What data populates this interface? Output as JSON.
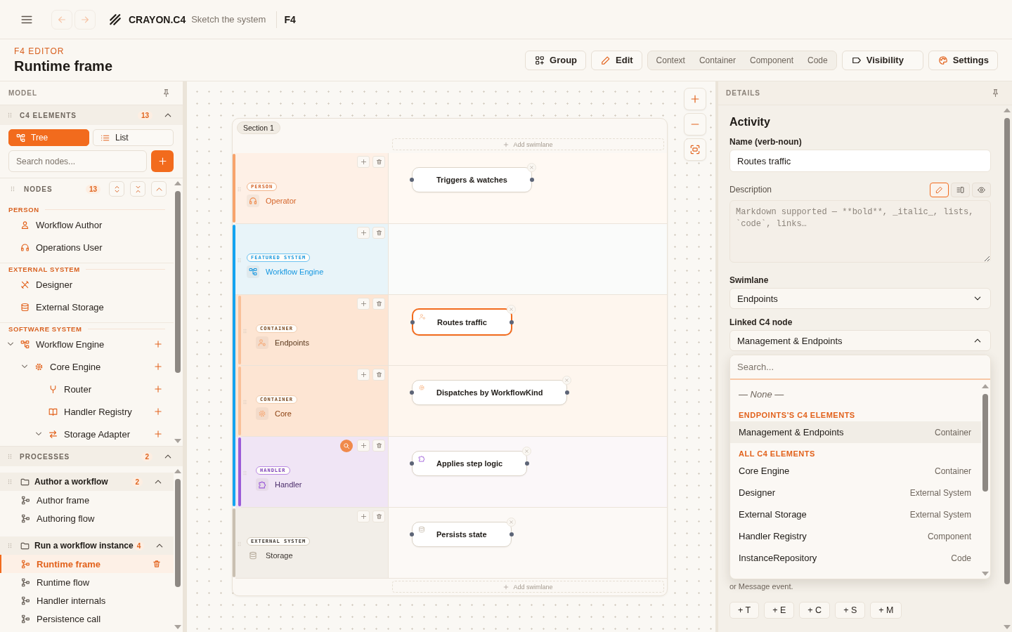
{
  "top_bar": {
    "nav_buttons": [
      {
        "kind": "back",
        "disabled": true
      },
      {
        "kind": "forward",
        "disabled": true
      }
    ],
    "app_name": "CRAYON.C4",
    "tagline": "Sketch the system",
    "document": "F4"
  },
  "header": {
    "eyebrow": "F4 EDITOR",
    "title": "Runtime frame",
    "toolbar": [
      {
        "kind": "group",
        "label": "Group"
      },
      {
        "kind": "edit",
        "label": "Edit"
      },
      {
        "kind": "levels",
        "options": [
          "Context",
          "Container",
          "Component",
          "Code"
        ]
      },
      {
        "kind": "visibility",
        "label": "Visibility"
      },
      {
        "kind": "settings",
        "label": "Settings"
      }
    ]
  },
  "sidebar": {
    "title": "MODEL",
    "c4_elements": {
      "title": "C4 ELEMENTS",
      "count": "13",
      "expanded": true,
      "view_modes": [
        {
          "kind": "tree",
          "label": "Tree",
          "selected": true
        },
        {
          "kind": "list",
          "label": "List",
          "selected": false
        }
      ],
      "search": {
        "placeholder": "Search nodes..."
      },
      "nodes_header": {
        "title": "NODES",
        "count": "13",
        "expanded": true
      },
      "groups": [
        {
          "title": "PERSON",
          "addable": false,
          "items": [
            {
              "label": "Workflow Author",
              "kind": "user"
            },
            {
              "label": "Operations User",
              "kind": "operator"
            }
          ]
        },
        {
          "title": "EXTERNAL SYSTEM",
          "addable": false,
          "items": [
            {
              "label": "Designer",
              "kind": "tools"
            },
            {
              "label": "External Storage",
              "kind": "database"
            }
          ]
        },
        {
          "title": "SOFTWARE SYSTEM",
          "addable": true,
          "items": [
            {
              "label": "Workflow Engine",
              "kind": "system",
              "expanded": true,
              "children": [
                {
                  "label": "Core Engine",
                  "kind": "engine",
                  "expanded": true,
                  "children": [
                    {
                      "label": "Router",
                      "kind": "router"
                    },
                    {
                      "label": "Handler Registry",
                      "kind": "registry"
                    },
                    {
                      "label": "Storage Adapter",
                      "kind": "adapter",
                      "expanded": true
                    }
                  ]
                }
              ]
            }
          ]
        }
      ]
    },
    "processes": {
      "title": "PROCESSES",
      "count": "2",
      "expanded": true,
      "groups": [
        {
          "title": "Author a workflow",
          "count": "2",
          "expanded": true,
          "items": [
            {
              "label": "Author frame",
              "selected": false
            },
            {
              "label": "Authoring flow",
              "selected": false
            }
          ]
        },
        {
          "title": "Run a workflow instance",
          "count": "4",
          "expanded": true,
          "items": [
            {
              "label": "Runtime frame",
              "selected": true
            },
            {
              "label": "Runtime flow",
              "selected": false
            },
            {
              "label": "Handler internals",
              "selected": false
            },
            {
              "label": "Persistence call",
              "selected": false
            }
          ]
        }
      ]
    }
  },
  "canvas": {
    "section": {
      "title": "Section 1",
      "add_lane_top": "Add swimlane",
      "add_lane_bottom": "Add swimlane",
      "lanes": [
        {
          "kind": "person",
          "badge": "PERSON",
          "name": "Operator",
          "color": "#f7a36b",
          "drilldown": false,
          "activity": {
            "label": "Triggers & watches",
            "selected": false,
            "icon": false
          }
        },
        {
          "kind": "system",
          "badge": "FEATURED SYSTEM",
          "name": "Workflow Engine",
          "color": "#14a3f0",
          "drilldown": false,
          "children": [
            {
              "kind": "api",
              "badge": "CONTAINER",
              "name": "Endpoints",
              "color": "#f9c199",
              "drilldown": false,
              "activity": {
                "label": "Routes traffic",
                "selected": true,
                "icon": true
              }
            },
            {
              "kind": "engine",
              "badge": "CONTAINER",
              "name": "Core",
              "color": "#f9c199",
              "drilldown": false,
              "activity": {
                "label": "Dispatches by WorkflowKind",
                "selected": false,
                "icon": true
              }
            },
            {
              "kind": "handler",
              "badge": "HANDLER",
              "name": "Handler",
              "color": "#9b5bd8",
              "drilldown": true,
              "activity": {
                "label": "Applies step logic",
                "selected": false,
                "icon": true
              }
            }
          ]
        },
        {
          "kind": "storage",
          "badge": "EXTERNAL SYSTEM",
          "name": "Storage",
          "color": "#c9bfb1",
          "drilldown": false,
          "activity": {
            "label": "Persists state",
            "selected": false,
            "icon": true
          }
        }
      ]
    }
  },
  "details": {
    "title": "DETAILS",
    "heading": "Activity",
    "name_field": {
      "label": "Name (verb-noun)",
      "value": "Routes traffic"
    },
    "description": {
      "label": "Description",
      "placeholder": "Markdown supported — **bold**, _italic_, lists, `code`, links…",
      "modes": [
        {
          "kind": "edit",
          "selected": true
        },
        {
          "kind": "split",
          "selected": false
        },
        {
          "kind": "preview",
          "selected": false
        }
      ]
    },
    "swimlane": {
      "label": "Swimlane",
      "value": "Endpoints",
      "expanded": false
    },
    "linked_node": {
      "label": "Linked C4 node",
      "value": "Management & Endpoints",
      "expanded": true,
      "dropdown": {
        "search_placeholder": "Search...",
        "none_option": "— None —",
        "groups": [
          {
            "title": "ENDPOINTS'S C4 ELEMENTS",
            "options": [
              {
                "label": "Management & Endpoints",
                "type": "Container",
                "selected": true
              }
            ]
          },
          {
            "title": "ALL C4 ELEMENTS",
            "options": [
              {
                "label": "Core Engine",
                "type": "Container",
                "selected": false
              },
              {
                "label": "Designer",
                "type": "External System",
                "selected": false
              },
              {
                "label": "External Storage",
                "type": "External System",
                "selected": false
              },
              {
                "label": "Handler Registry",
                "type": "Component",
                "selected": false
              },
              {
                "label": "InstanceRepository",
                "type": "Code",
                "selected": false
              }
            ]
          }
        ]
      }
    },
    "events_hint": "or Message event.",
    "event_buttons": [
      "+ T",
      "+ E",
      "+ C",
      "+ S",
      "+ M"
    ]
  }
}
